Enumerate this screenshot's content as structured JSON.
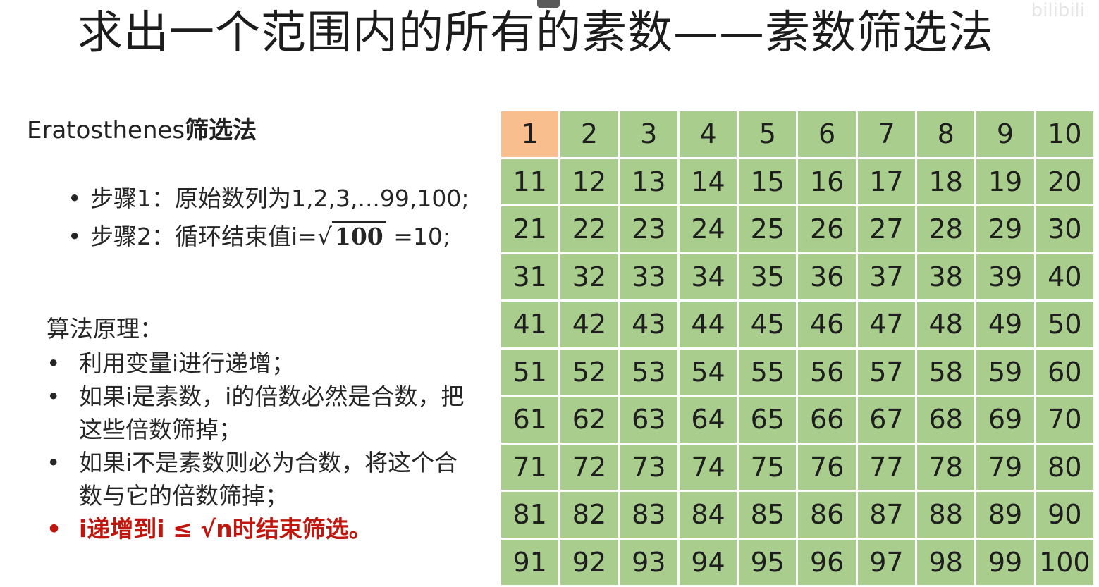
{
  "title": "求出一个范围内的所有的素数——素数筛选法",
  "subtitle": {
    "latin": "Eratosthenes",
    "cjk": "筛选法"
  },
  "steps": [
    {
      "text": "步骤1：原始数列为1,2,3,...99,100;"
    },
    {
      "prefix": "步骤2：循环结束值i=",
      "radicand": "100",
      "suffix": " =10;"
    }
  ],
  "principle_heading": "算法原理：",
  "principles": [
    "利用变量i进行递增；",
    "如果i是素数，i的倍数必然是合数，把这些倍数筛掉；",
    "如果i不是素数则必为合数，将这个合数与它的倍数筛掉；",
    "i递增到i ≤ √n时结束筛选。"
  ],
  "grid": {
    "numbers": [
      1,
      2,
      3,
      4,
      5,
      6,
      7,
      8,
      9,
      10,
      11,
      12,
      13,
      14,
      15,
      16,
      17,
      18,
      19,
      20,
      21,
      22,
      23,
      24,
      25,
      26,
      27,
      28,
      29,
      30,
      31,
      32,
      33,
      34,
      35,
      36,
      37,
      38,
      39,
      40,
      41,
      42,
      43,
      44,
      45,
      46,
      47,
      48,
      49,
      50,
      51,
      52,
      53,
      54,
      55,
      56,
      57,
      58,
      59,
      60,
      61,
      62,
      63,
      64,
      65,
      66,
      67,
      68,
      69,
      70,
      71,
      72,
      73,
      74,
      75,
      76,
      77,
      78,
      79,
      80,
      81,
      82,
      83,
      84,
      85,
      86,
      87,
      88,
      89,
      90,
      91,
      92,
      93,
      94,
      95,
      96,
      97,
      98,
      99,
      100
    ],
    "highlighted": [
      1
    ],
    "colors": {
      "normal": "#a8cd8c",
      "highlight": "#f8be8e"
    }
  },
  "watermark": "bilibili"
}
